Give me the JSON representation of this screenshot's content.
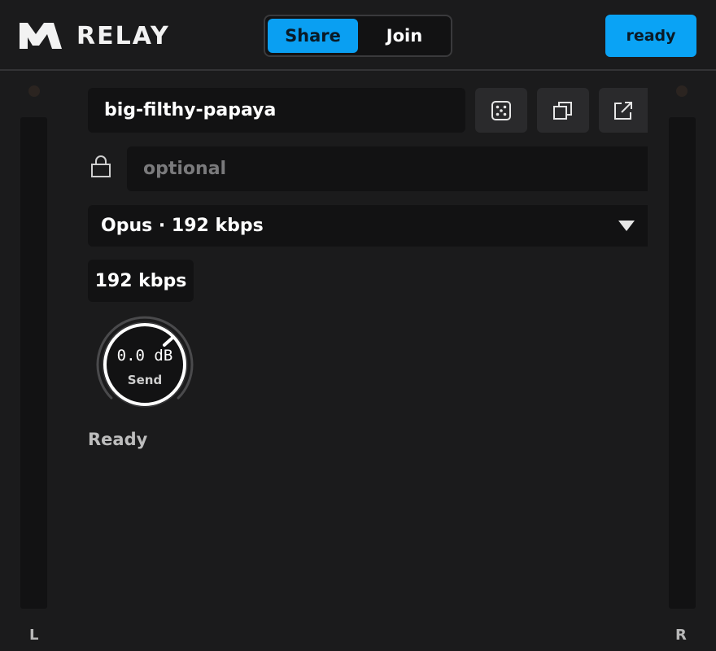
{
  "header": {
    "app_name": "RELAY",
    "mode_tabs": [
      {
        "label": "Share",
        "selected": true
      },
      {
        "label": "Join",
        "selected": false
      }
    ],
    "status_button": "ready"
  },
  "session": {
    "room_name": "big-filthy-papaya",
    "password_placeholder": "optional",
    "password_value": "",
    "actions": [
      "dice-icon",
      "copy-icon",
      "external-link-icon"
    ]
  },
  "codec": {
    "selected": "Opus · 192 kbps",
    "bitrate_label": "192 kbps"
  },
  "send_knob": {
    "value": "0.0 dB",
    "label": "Send"
  },
  "status": "Ready",
  "meters": {
    "left_label": "L",
    "right_label": "R",
    "left_level": 0,
    "right_level": 0
  },
  "colors": {
    "accent": "#0aa3f5",
    "background": "#1b1b1c",
    "field": "#121213"
  }
}
